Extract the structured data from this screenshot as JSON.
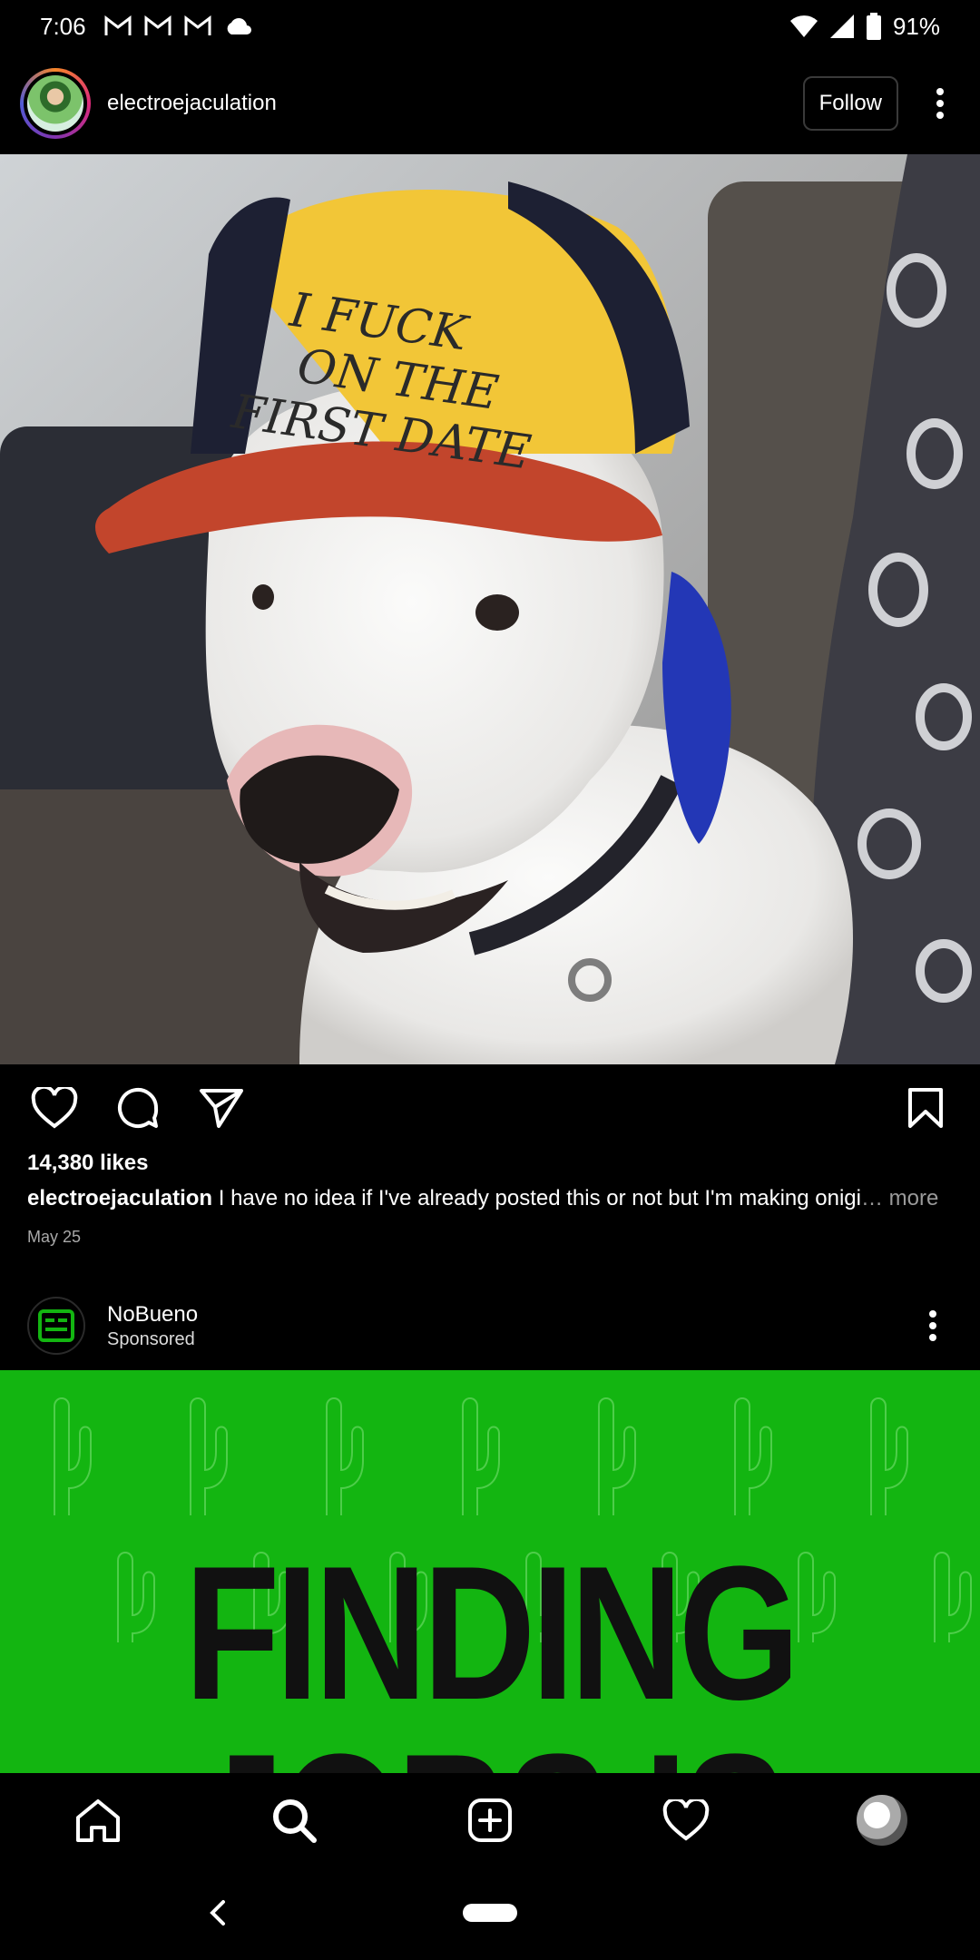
{
  "status_bar": {
    "time": "7:06",
    "battery": "91%",
    "icons": [
      "gmail-icon",
      "gmail-icon",
      "gmail-icon",
      "cloud-icon",
      "wifi-icon",
      "signal-icon",
      "battery-icon"
    ]
  },
  "post": {
    "username": "electroejaculation",
    "follow_label": "Follow",
    "image_hat_text": "I FUCK ON THE FIRST DATE",
    "likes": "14,380 likes",
    "caption_user": "electroejaculation",
    "caption_text": "I have no idea if I've already posted this or not but I'm making onigi",
    "caption_more": "… more",
    "date": "May 25"
  },
  "sponsored": {
    "name": "NoBueno",
    "label": "Sponsored",
    "ad_line1": "FINDING",
    "ad_line2": "JOBS IS"
  },
  "colors": {
    "background": "#000000",
    "ad_green": "#13B511",
    "secondary_text": "#A8A8A8"
  }
}
